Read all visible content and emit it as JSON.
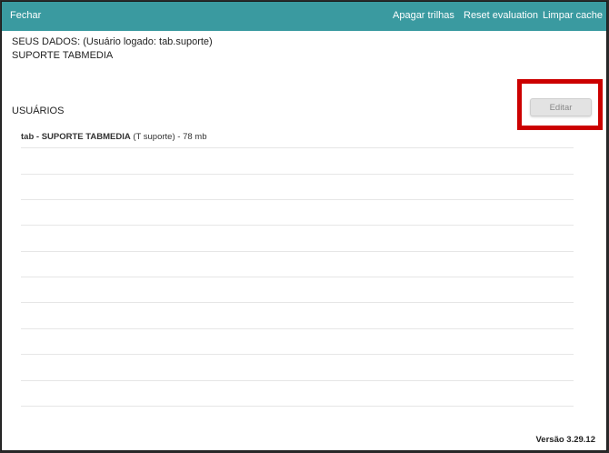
{
  "topbar": {
    "close_label": "Fechar",
    "actions": [
      {
        "label": "Apagar trilhas"
      },
      {
        "label": "Reset evaluation"
      },
      {
        "label": "Limpar cache"
      }
    ],
    "color": "#3a9aa0"
  },
  "user_info": {
    "heading": "SEUS DADOS: (Usuário logado: tab.suporte)",
    "name": "SUPORTE TABMEDIA"
  },
  "users_section": {
    "title": "USUÁRIOS",
    "edit_label": "Editar",
    "highlight_color": "#cc0000",
    "rows": [
      {
        "login": "tab",
        "separator": " - ",
        "name": "SUPORTE TABMEDIA",
        "detail": " (T suporte) - 78 mb"
      }
    ]
  },
  "footer": {
    "version": "Versão 3.29.12"
  }
}
